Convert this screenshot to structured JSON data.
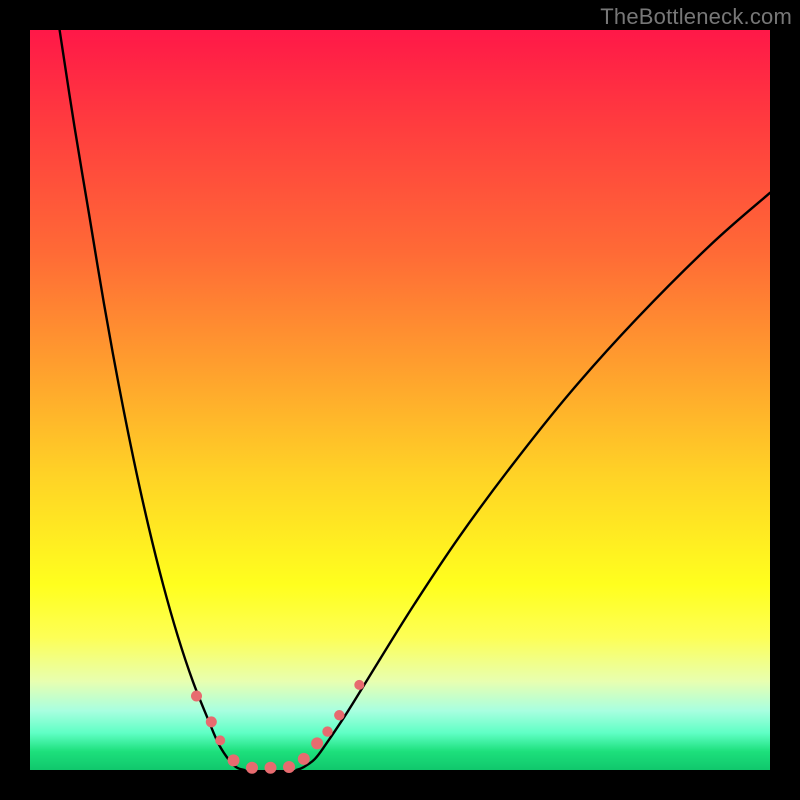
{
  "watermark": "TheBottleneck.com",
  "chart_data": {
    "type": "line",
    "title": "",
    "xlabel": "",
    "ylabel": "",
    "xlim": [
      0,
      100
    ],
    "ylim": [
      0,
      100
    ],
    "series": [
      {
        "name": "left-curve",
        "x": [
          4,
          6,
          8,
          10,
          12,
          14,
          16,
          18,
          20,
          22,
          24,
          25.5,
          27,
          28,
          29
        ],
        "y": [
          100,
          87,
          75,
          63,
          52,
          42,
          33,
          25,
          18,
          12,
          7,
          3.5,
          1.2,
          0.3,
          0
        ]
      },
      {
        "name": "right-curve",
        "x": [
          36,
          37,
          38.5,
          40,
          43,
          47,
          52,
          58,
          65,
          73,
          82,
          92,
          100
        ],
        "y": [
          0,
          0.4,
          1.5,
          3.5,
          8,
          14.5,
          22.5,
          31.5,
          41,
          51,
          61,
          71,
          78
        ]
      }
    ],
    "markers": [
      {
        "x": 22.5,
        "y": 10,
        "r": 5.5,
        "color": "#e76b6f"
      },
      {
        "x": 24.5,
        "y": 6.5,
        "r": 5.5,
        "color": "#e76b6f"
      },
      {
        "x": 25.7,
        "y": 4.0,
        "r": 5.0,
        "color": "#e76b6f"
      },
      {
        "x": 27.5,
        "y": 1.3,
        "r": 6.0,
        "color": "#e76b6f"
      },
      {
        "x": 30.0,
        "y": 0.3,
        "r": 6.0,
        "color": "#e76b6f"
      },
      {
        "x": 32.5,
        "y": 0.3,
        "r": 6.0,
        "color": "#e76b6f"
      },
      {
        "x": 35.0,
        "y": 0.4,
        "r": 6.0,
        "color": "#e76b6f"
      },
      {
        "x": 37.0,
        "y": 1.5,
        "r": 6.0,
        "color": "#e76b6f"
      },
      {
        "x": 38.8,
        "y": 3.6,
        "r": 6.0,
        "color": "#e76b6f"
      },
      {
        "x": 40.2,
        "y": 5.2,
        "r": 5.2,
        "color": "#e76b6f"
      },
      {
        "x": 41.8,
        "y": 7.4,
        "r": 5.2,
        "color": "#e76b6f"
      },
      {
        "x": 44.5,
        "y": 11.5,
        "r": 5.0,
        "color": "#e76b6f"
      }
    ],
    "gradient_stops": [
      {
        "pos": 0,
        "color": "#ff1848"
      },
      {
        "pos": 0.3,
        "color": "#ff6a36"
      },
      {
        "pos": 0.6,
        "color": "#ffd226"
      },
      {
        "pos": 0.82,
        "color": "#fdff55"
      },
      {
        "pos": 0.95,
        "color": "#5fffc5"
      },
      {
        "pos": 1.0,
        "color": "#10c76c"
      }
    ]
  }
}
